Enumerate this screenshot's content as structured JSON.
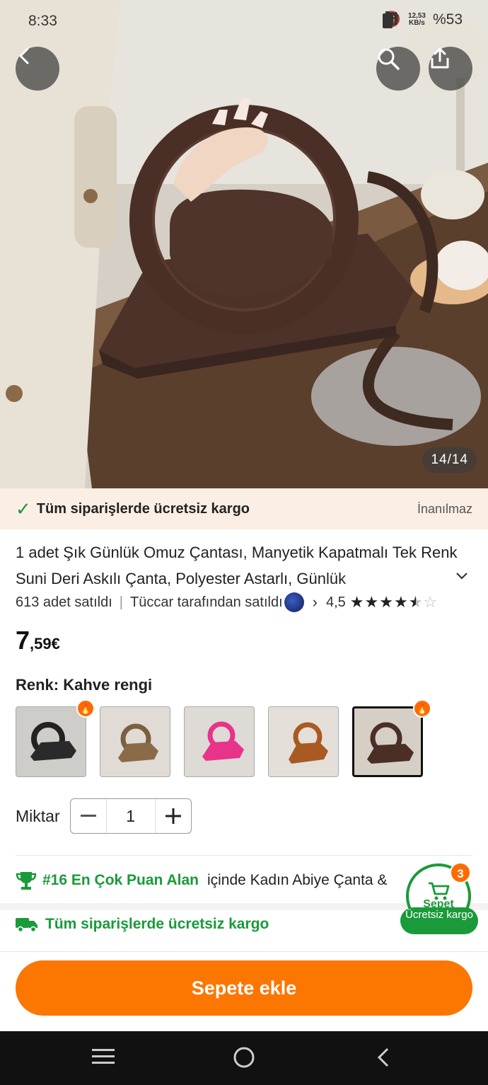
{
  "status_bar": {
    "time": "8:33",
    "net_speed_value": "12,53",
    "net_speed_unit": "KB/s",
    "battery": "%53"
  },
  "gallery": {
    "counter": "14/14"
  },
  "ship_banner": {
    "text": "Tüm siparişlerde ücretsiz kargo",
    "tag": "İnanılmaz"
  },
  "product": {
    "title": "1 adet Şık Günlük Omuz Çantası, Manyetik Kapatmalı Tek Renk Suni Deri Askılı Çanta, Polyester Astarlı, Günlük",
    "sold": "613 adet satıldı",
    "seller": "Tüccar tarafından satıldı",
    "rating": "4,5",
    "rating_value": 4.5,
    "price_int": "7",
    "price_dec": ",59€"
  },
  "color": {
    "label": "Renk: Kahve rengi"
  },
  "swatches": [
    {
      "name": "black",
      "color": "#2a2a2a",
      "hot": true
    },
    {
      "name": "khaki",
      "color": "#8a6a48",
      "hot": false
    },
    {
      "name": "pink",
      "color": "#e8338a",
      "hot": false
    },
    {
      "name": "brown",
      "color": "#a85a22",
      "hot": false
    },
    {
      "name": "coffee",
      "color": "#4b2e25",
      "hot": true,
      "selected": true
    }
  ],
  "quantity": {
    "label": "Miktar",
    "value": "1"
  },
  "ranking": {
    "green": "#16 En Çok Puan Alan",
    "rest": "içinde Kadın Abiye Çanta &"
  },
  "shipping": {
    "text": "Tüm siparişlerde ücretsiz kargo"
  },
  "cart": {
    "label": "Sepet",
    "count": "3",
    "pill": "Ücretsiz kargo"
  },
  "cta": {
    "label": "Sepete ekle"
  },
  "colors": {
    "accent": "#fb7701",
    "green": "#1a9a3a"
  }
}
